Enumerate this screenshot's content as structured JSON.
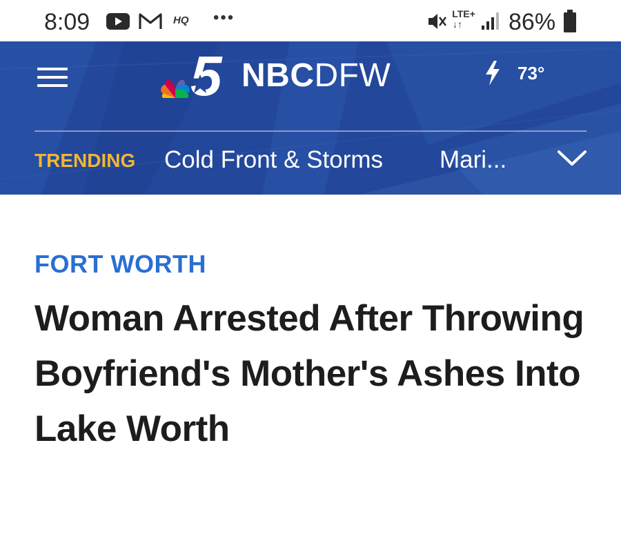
{
  "status_bar": {
    "time": "8:09",
    "notification_icons": [
      "youtube-icon",
      "gmail-icon",
      "hq-icon",
      "more-dots-icon"
    ],
    "hq_text": "HQ",
    "more_text": "•••",
    "network_type": "LTE+",
    "network_arrows": "↓↑",
    "battery_percent": "86%"
  },
  "header": {
    "brand_nbc": "NBC",
    "brand_dfw": "DFW",
    "logo_number": "5",
    "weather_temp": "73°",
    "trending_label": "TRENDING",
    "trending_links": [
      "Cold Front & Storms",
      "Mari..."
    ],
    "colors": {
      "header_bg": "#23479a",
      "trending_label": "#f2b632",
      "section_tag": "#2a6fd1"
    }
  },
  "article": {
    "section": "FORT WORTH",
    "headline": "Woman Arrested After Throwing Boyfriend's Mother's Ashes Into Lake Worth"
  }
}
